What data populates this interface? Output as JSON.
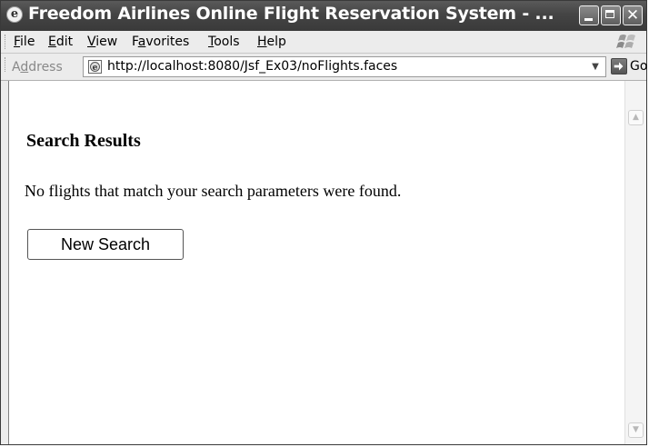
{
  "window": {
    "title": "Freedom Airlines Online Flight Reservation System - ...",
    "app_icon_glyph": "e",
    "close_glyph": "✕"
  },
  "menu": {
    "items": [
      {
        "label": "File",
        "accel": "F"
      },
      {
        "label": "Edit",
        "accel": "E"
      },
      {
        "label": "View",
        "accel": "V"
      },
      {
        "label": "Favorites",
        "accel": "a"
      },
      {
        "label": "Tools",
        "accel": "T"
      },
      {
        "label": "Help",
        "accel": "H"
      }
    ]
  },
  "address": {
    "label": "Address",
    "url": "http://localhost:8080/Jsf_Ex03/noFlights.faces",
    "dropdown_glyph": "▼",
    "go_label": "Go"
  },
  "content": {
    "heading": "Search Results",
    "message": "No flights that match your search parameters were found.",
    "new_search_label": "New Search"
  },
  "scrollbar": {
    "up_glyph": "▲",
    "down_glyph": "▼"
  },
  "icons": {
    "app": "ie-page-icon",
    "page": "web-page-icon",
    "logo": "windows-logo-icon",
    "go": "go-arrow-icon"
  }
}
